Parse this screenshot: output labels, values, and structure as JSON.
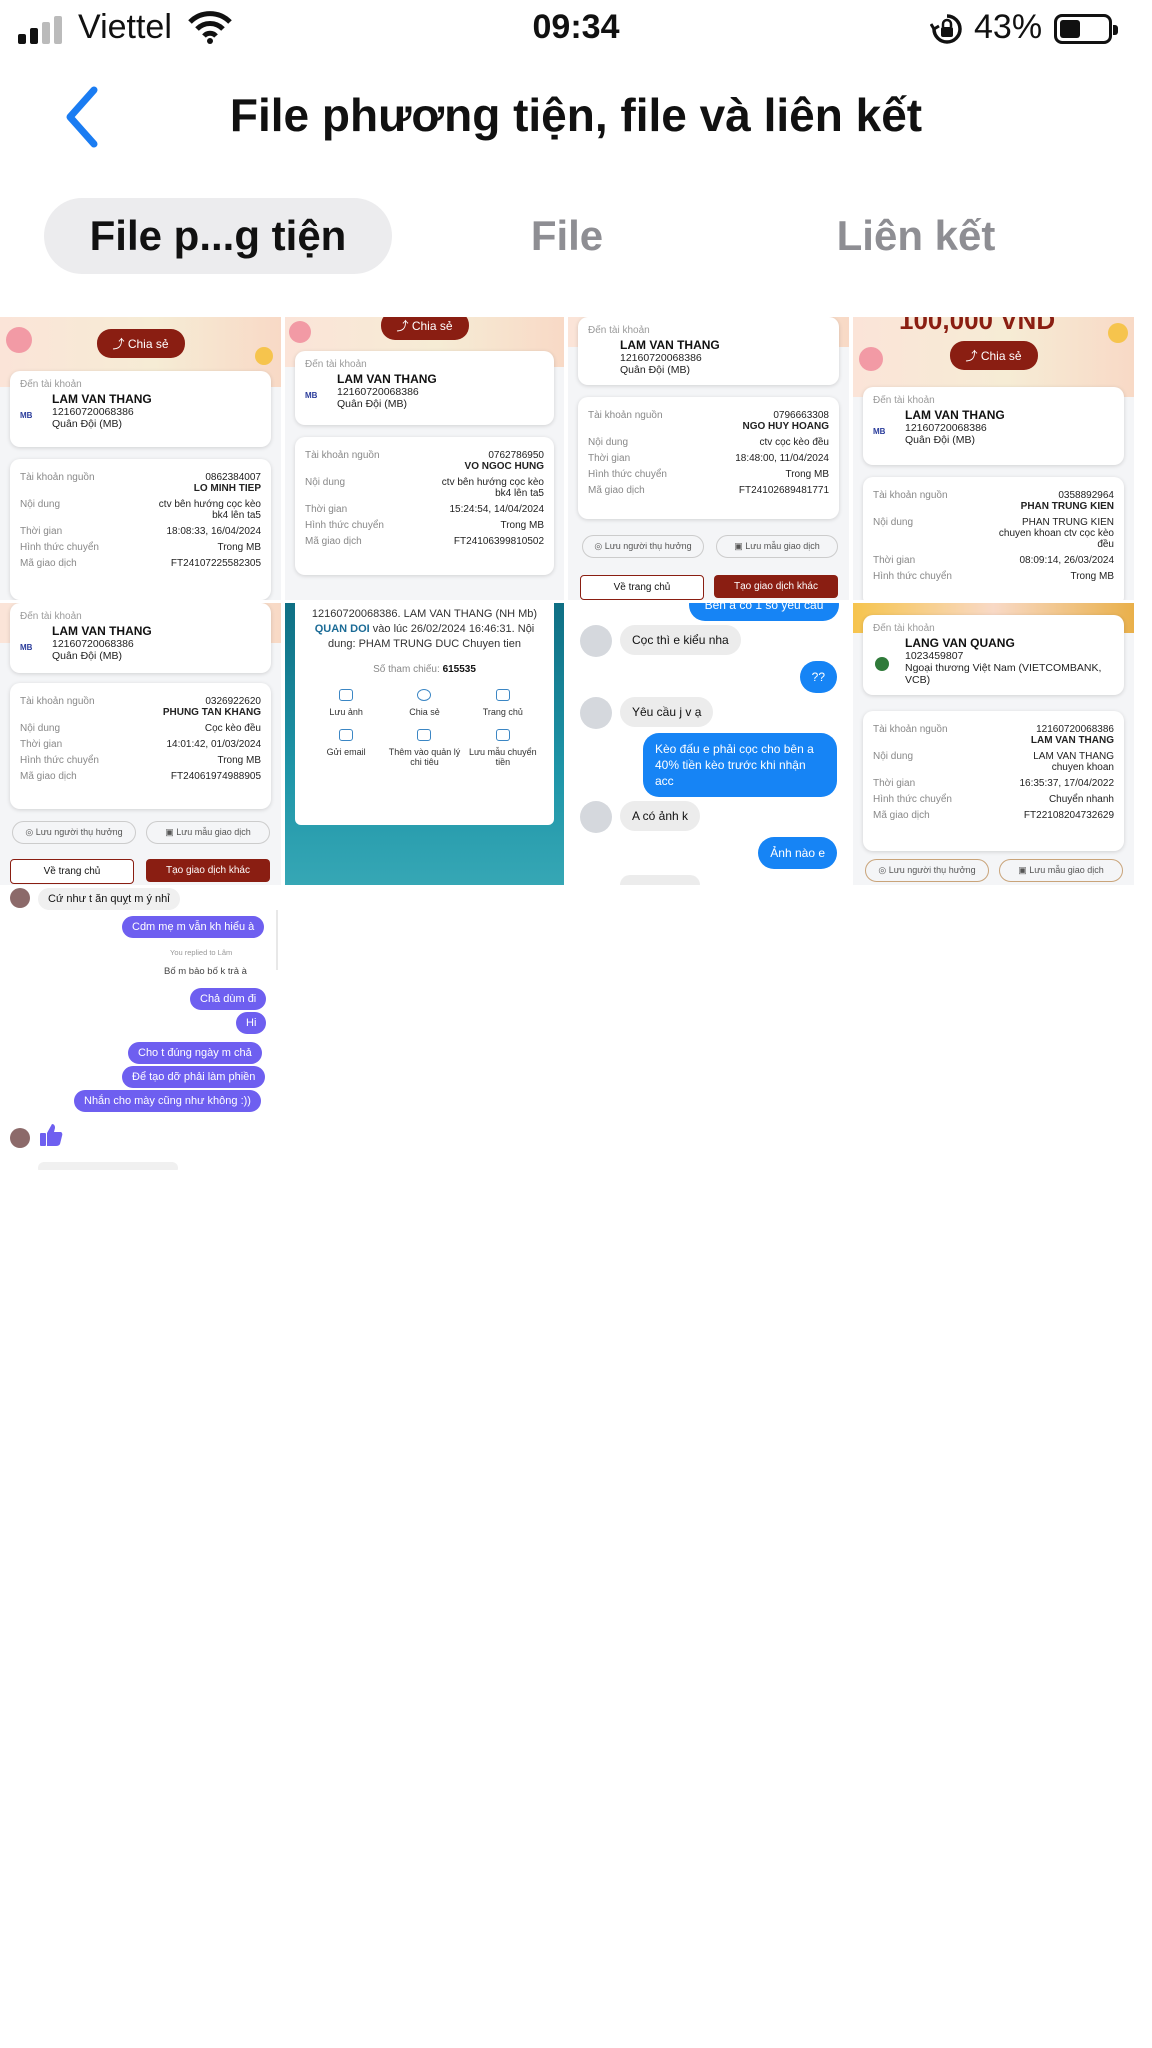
{
  "status_bar": {
    "carrier": "Viettel",
    "time": "09:34",
    "battery": "43%",
    "battery_level": 0.43
  },
  "nav": {
    "title": "File phương tiện, file và liên kết"
  },
  "tabs": [
    {
      "label": "File p...g tiện",
      "active": true
    },
    {
      "label": "File",
      "active": false
    },
    {
      "label": "Liên kết",
      "active": false
    }
  ],
  "common": {
    "to_account": "Đến tài khoản",
    "source_account": "Tài khoản nguồn",
    "content": "Nội dung",
    "time": "Thời gian",
    "transfer_type": "Hình thức chuyển",
    "transaction_code": "Mã giao dịch",
    "share": "Chia sẻ",
    "save_beneficiary": "Lưu người thụ hưởng",
    "save_template": "Lưu mẫu giao dịch",
    "home": "Về trang chủ",
    "new_transaction": "Tạo giao dịch khác",
    "recipient_name": "LAM VAN THANG",
    "recipient_account": "12160720068386",
    "recipient_bank": "Quân Đội (MB)",
    "mb": "MB"
  },
  "receipts": {
    "r1": {
      "source_acc": "0862384007",
      "source_name": "LO MINH TIEP",
      "content": "ctv bên hướng cọc kèo bk4 lên ta5",
      "time": "18:08:33, 16/04/2024",
      "type": "Trong MB",
      "code": "FT24107225582305"
    },
    "r2": {
      "source_acc": "0762786950",
      "source_name": "VO NGOC HUNG",
      "content": "ctv bên hướng cọc kèo bk4 lên ta5",
      "time": "15:24:54, 14/04/2024",
      "type": "Trong MB",
      "code": "FT24106399810502"
    },
    "r3": {
      "source_acc": "0796663308",
      "source_name": "NGO HUY HOANG",
      "content": "ctv cọc kèo đều",
      "time": "18:48:00, 11/04/2024",
      "type": "Trong MB",
      "code": "FT24102689481771"
    },
    "r4": {
      "banner_amount": "100,000 VND",
      "source_acc": "0358892964",
      "source_name": "PHAN TRUNG KIEN",
      "content": "PHAN TRUNG KIEN chuyen khoan ctv cọc kèo đều",
      "time": "08:09:14, 26/03/2024",
      "type": "Trong MB"
    },
    "r5": {
      "source_acc": "0326922620",
      "source_name": "PHUNG TAN KHANG",
      "content": "Cọc kèo đều",
      "time": "14:01:42, 01/03/2024",
      "type": "Trong MB",
      "code": "FT24061974988905"
    },
    "r6": {
      "line1": "12160720068386. LAM VAN THANG (NH Mb)",
      "bank": "QUAN DOI",
      "line2": "vào lúc 26/02/2024 16:46:31. Nội dung: PHAM TRUNG DUC Chuyen tien",
      "ref_label": "Số tham chiếu:",
      "ref": "615535",
      "actions": [
        "Lưu ảnh",
        "Chia sẻ",
        "Trang chủ",
        "Gửi email",
        "Thêm vào quản lý chi tiêu",
        "Lưu mẫu chuyển tiền"
      ]
    },
    "r8": {
      "name": "LANG VAN QUANG",
      "account": "1023459807",
      "bank": "Ngoại thương Việt Nam (VIETCOMBANK, VCB)",
      "source_acc": "12160720068386",
      "source_name": "LAM VAN THANG",
      "content": "LAM VAN THANG chuyen khoan",
      "time": "16:35:37, 17/04/2022",
      "type": "Chuyển nhanh",
      "code": "FT22108204732629"
    }
  },
  "chat": {
    "top": "Bên a có 1 số yêu cầu",
    "m1": "Cọc thì e kiểu nha",
    "m2": "??",
    "m3": "Yêu cầu j v ạ",
    "m4": "Kèo đấu e phải cọc cho bên a 40% tiền kèo trước khi nhận acc",
    "m5": "A có ảnh k",
    "m6": "Ảnh nào e"
  },
  "messenger": {
    "m1": "Cứ như t ăn quỵt m ý nhỉ",
    "m2": "Cdm mẹ m vẫn kh hiểu à",
    "note": "You replied to Lâm",
    "m3": "Bố m bảo bố k trả à",
    "m4": "Chả dùm đi",
    "m5": "Hi",
    "m6": "Cho t đúng ngày m chả",
    "m7": "Để tạo dỡ phải làm phiền",
    "m8": "Nhắn cho mày cũng như không :))"
  }
}
